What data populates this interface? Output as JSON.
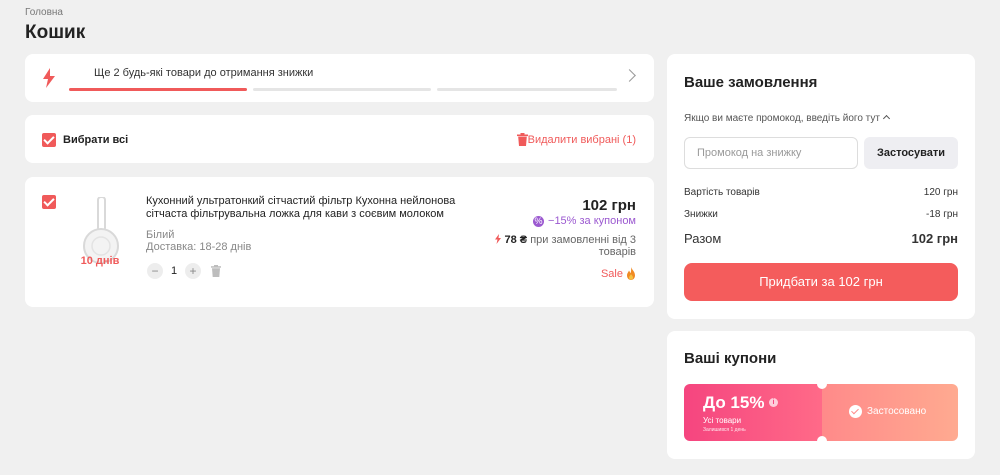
{
  "breadcrumb": "Головна",
  "page_title": "Кошик",
  "colors": {
    "accent": "#f05a5a",
    "coupon_purple": "#9b59d0",
    "buy_button": "#f45c5c"
  },
  "promo": {
    "text": "Ще 2 будь-які товари до отримання знижки",
    "progress_steps": 3,
    "completed_steps": 1,
    "icon": "lightning-icon"
  },
  "select_all": {
    "label": "Вибрати всі",
    "checked": true,
    "delete_label": "Видалити вибрані (1)"
  },
  "product": {
    "checked": true,
    "delivery_badge": "10 днів",
    "name": "Кухонний ультратонкий сітчастий фільтр Кухонна нейлонова сітчаста фільтрувальна ложка для кави з соєвим молоком",
    "color": "Білий",
    "delivery": "Доставка: 18-28 днів",
    "quantity": "1",
    "minus": "−",
    "plus": "+",
    "price": "102 грн",
    "coupon_text": "−15% за купоном",
    "bulk_price": "78 ₴",
    "bulk_text": "при замовленні від 3 товарів",
    "sale_label": "Sale"
  },
  "order": {
    "title": "Ваше замовлення",
    "promo_hint": "Якщо ви маєте промокод, введіть його тут",
    "promo_placeholder": "Промокод на знижку",
    "apply_label": "Застосувати",
    "rows": [
      {
        "label": "Вартість товарів",
        "value": "120 грн"
      },
      {
        "label": "Знижки",
        "value": "-18 грн"
      }
    ],
    "total_label": "Разом",
    "total_value": "102 грн",
    "buy_label": "Придбати за 102 грн"
  },
  "coupons": {
    "title": "Ваші купони",
    "items": [
      {
        "discount": "До 15%",
        "scope": "Усі товари",
        "remaining": "Залишився 1 день",
        "status": "Застосовано"
      }
    ]
  }
}
